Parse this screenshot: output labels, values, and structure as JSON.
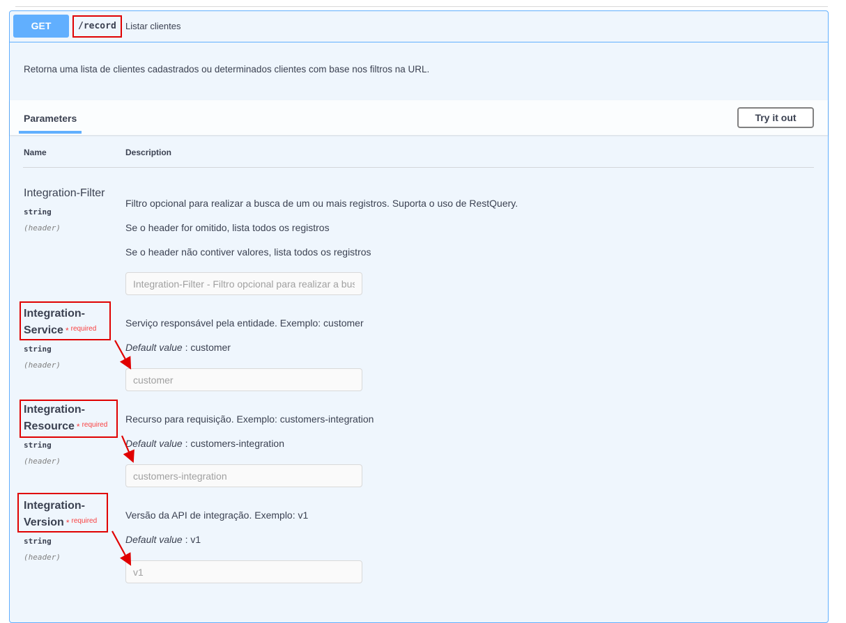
{
  "summary": {
    "method": "GET",
    "path": "/record",
    "description": "Listar clientes"
  },
  "description": "Retorna uma lista de clientes cadastrados ou determinados clientes com base nos filtros na URL.",
  "section": {
    "tab_label": "Parameters",
    "try_button": "Try it out"
  },
  "columns": {
    "name": "Name",
    "description": "Description"
  },
  "params": [
    {
      "name": "Integration-Filter",
      "type": "string",
      "in": "(header)",
      "lines": [
        "Filtro opcional para realizar a busca de um ou mais registros. Suporta o uso de RestQuery.",
        "Se o header for omitido, lista todos os registros",
        "Se o header não contiver valores, lista todos os registros"
      ],
      "placeholder": "Integration-Filter - Filtro opcional para realizar a bus"
    },
    {
      "name_1": "Integration-",
      "name_2": "Service",
      "star": "*",
      "required": "required",
      "type": "string",
      "in": "(header)",
      "description": "Serviço responsável pela entidade. Exemplo: customer",
      "default_label": "Default value",
      "default_sep": " : ",
      "default_value": "customer",
      "placeholder": "customer"
    },
    {
      "name_1": "Integration-",
      "name_2": "Resource",
      "star": "*",
      "required": "required",
      "type": "string",
      "in": "(header)",
      "description": "Recurso para requisição. Exemplo: customers-integration",
      "default_label": "Default value",
      "default_sep": " : ",
      "default_value": "customers-integration",
      "placeholder": "customers-integration"
    },
    {
      "name_1": "Integration-",
      "name_2": "Version",
      "star": "*",
      "required": "required",
      "type": "string",
      "in": "(header)",
      "description": "Versão da API de integração. Exemplo: v1",
      "default_label": "Default value",
      "default_sep": " : ",
      "default_value": "v1",
      "placeholder": "v1"
    }
  ],
  "colors": {
    "get": "#61affe",
    "highlight": "#e00000",
    "required": "#f93e3e"
  }
}
